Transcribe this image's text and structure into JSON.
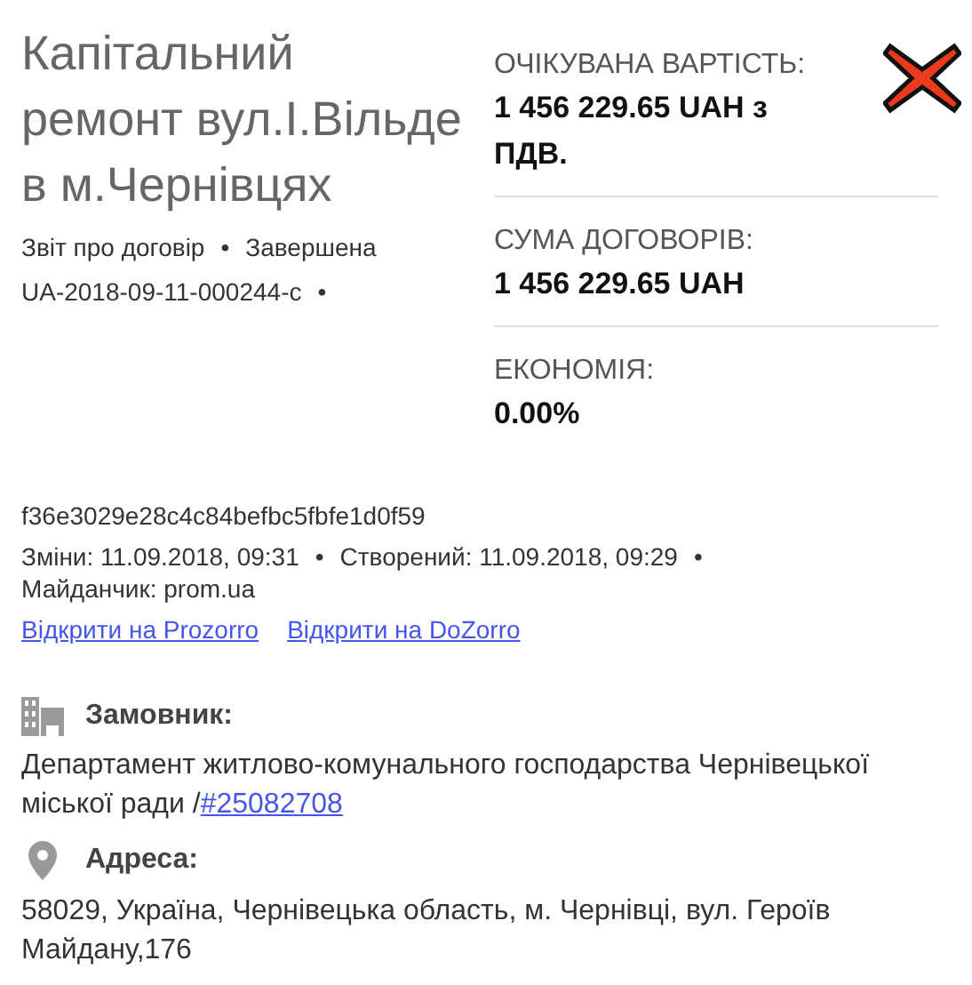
{
  "title": "Капітальний ремонт вул.І.Вільде в м.Чернівцях",
  "meta_lines": [
    [
      "Звіт про договір",
      "•",
      "Завершена"
    ],
    [
      "UA-2018-09-11-000244-c",
      "•"
    ]
  ],
  "summary": [
    {
      "label": "ОЧІКУВАНА ВАРТІСТЬ:",
      "value": "1 456 229.65 UAH з ПДВ."
    },
    {
      "label": "СУМА ДОГОВОРІВ:",
      "value": "1 456 229.65 UAH"
    },
    {
      "label": "ЕКОНОМІЯ:",
      "value": "0.00%"
    }
  ],
  "hash": "f36e3029e28c4c84befbc5fbfe1d0f59",
  "detail_lines": [
    [
      "Зміни: 11.09.2018, 09:31",
      "•",
      "Створений: 11.09.2018, 09:29",
      "•"
    ],
    [
      "Майданчик: prom.ua"
    ]
  ],
  "links": [
    "Відкрити на Prozorro",
    "Відкрити на DoZorro"
  ],
  "sections": [
    {
      "kind": "customer",
      "heading": "Замовник:",
      "text": "Департамент житлово-комунального господарства Чернівецької міської ради /",
      "link": "#25082708"
    },
    {
      "kind": "address",
      "heading": "Адреса:",
      "text": "58029, Україна, Чернівецька область, м. Чернівці, вул. Героїв Майдану,176"
    }
  ]
}
